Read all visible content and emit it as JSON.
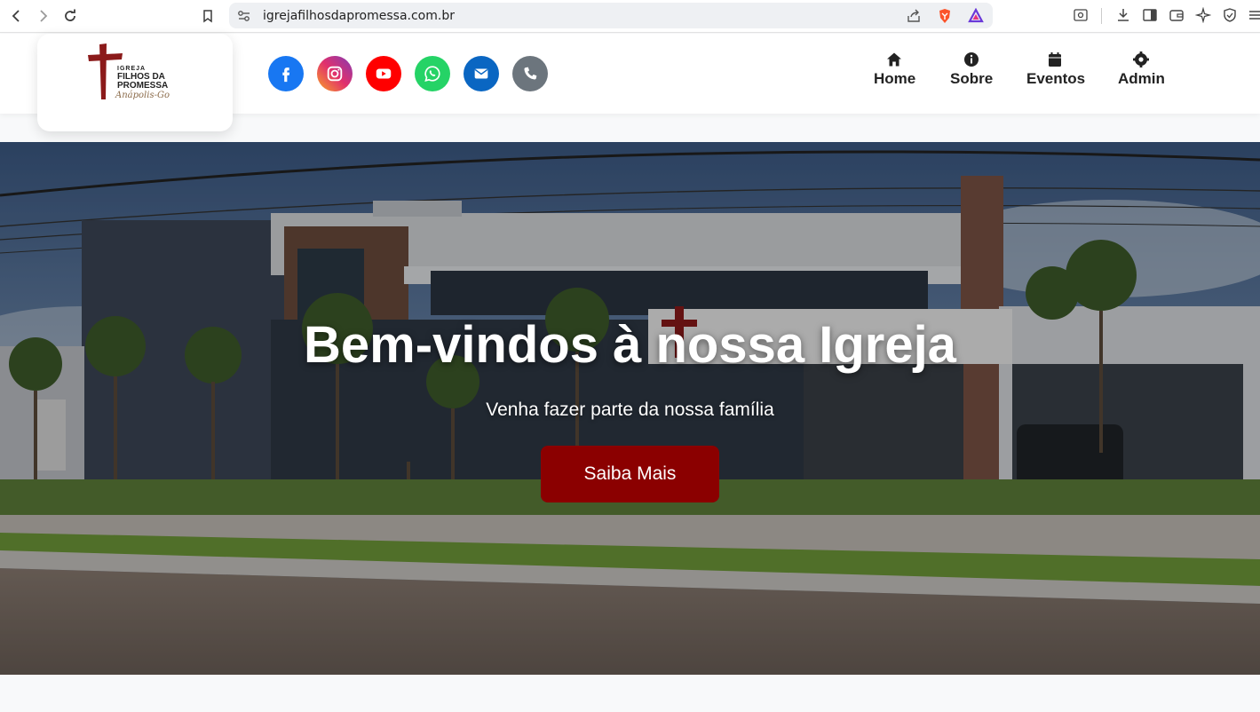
{
  "browser": {
    "url": "igrejafilhosdapromessa.com.br"
  },
  "logo": {
    "line1": "IGREJA",
    "line2": "FILHOS DA",
    "line3": "PROMESSA",
    "signature": "Anápolis-Go"
  },
  "social": [
    {
      "icon": "facebook-icon",
      "color": "#1877f2"
    },
    {
      "icon": "instagram-icon",
      "color": "#d6249f"
    },
    {
      "icon": "youtube-icon",
      "color": "#ff0000"
    },
    {
      "icon": "whatsapp-icon",
      "color": "#25d366"
    },
    {
      "icon": "envelope-icon",
      "color": "#0a66c2"
    },
    {
      "icon": "phone-icon",
      "color": "#6c757d"
    }
  ],
  "menu": {
    "home": "Home",
    "sobre": "Sobre",
    "eventos": "Eventos",
    "admin": "Admin"
  },
  "hero": {
    "title": "Bem-vindos à nossa Igreja",
    "subtitle": "Venha fazer parte da nossa família",
    "button": "Saiba Mais",
    "button_color": "#8b0000"
  }
}
